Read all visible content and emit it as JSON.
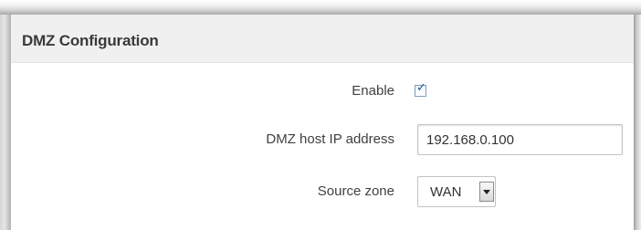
{
  "section": {
    "title": "DMZ Configuration"
  },
  "form": {
    "enable": {
      "label": "Enable",
      "checked": true
    },
    "host_ip": {
      "label": "DMZ host IP address",
      "value": "192.168.0.100"
    },
    "source_zone": {
      "label": "Source zone",
      "selected": "WAN"
    }
  },
  "icons": {
    "checkbox_mark": "checkmark-icon",
    "dropdown_arrow": "chevron-down-icon"
  },
  "colors": {
    "header_bg": "#f0f0f0",
    "title_text": "#3a3a3a",
    "label_text": "#404040",
    "checkbox_border": "#7f9db9",
    "checkmark": "#2a4f9a"
  }
}
